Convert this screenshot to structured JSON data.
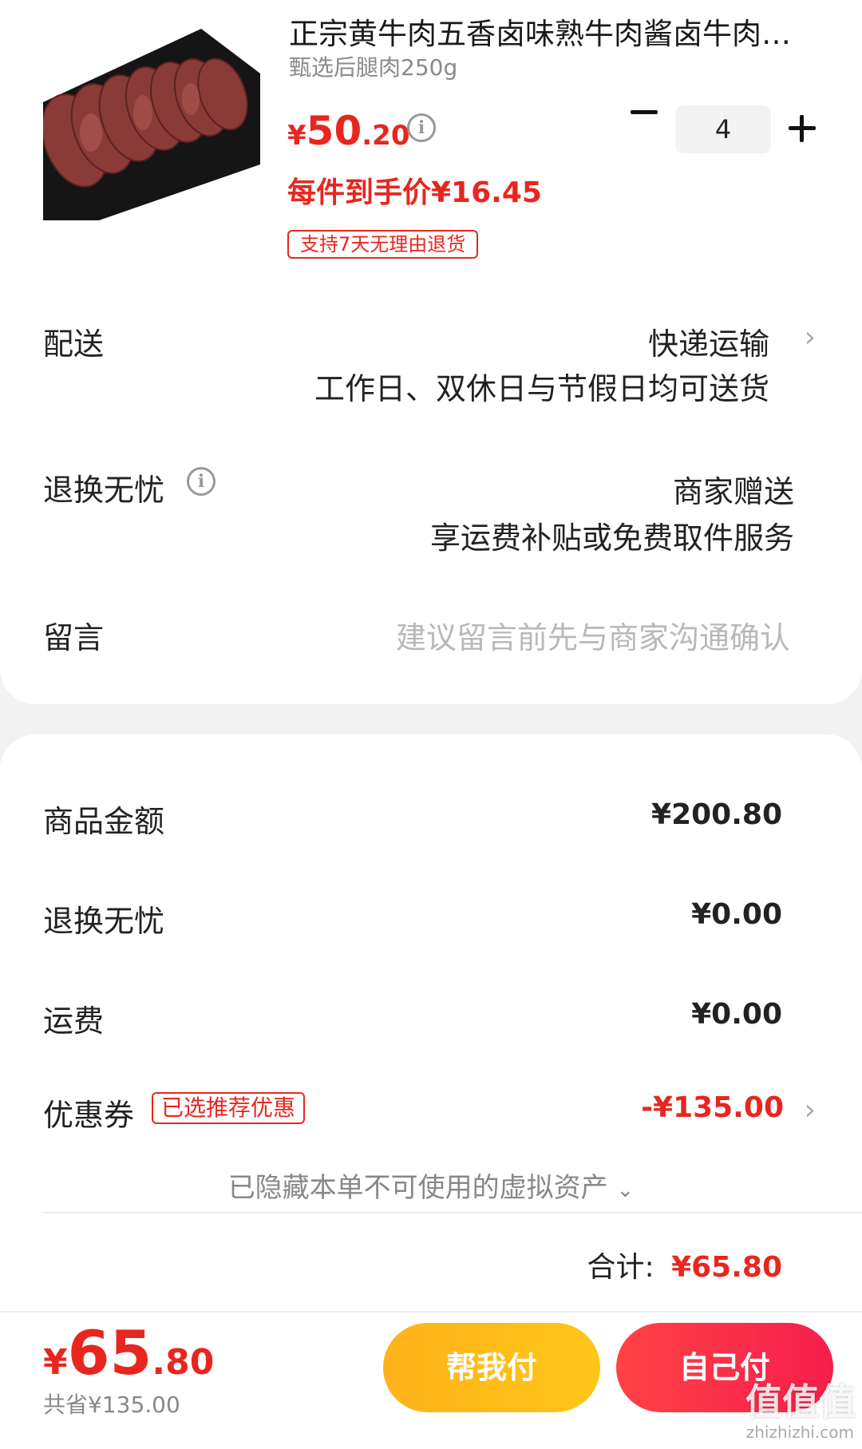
{
  "product": {
    "title": "正宗黄牛肉五香卤味熟牛肉酱卤牛肉…",
    "spec": "甄选后腿肉250g",
    "price_symbol": "¥",
    "price_int": "50",
    "price_dec": ".20",
    "unit_price": "每件到手价¥16.45",
    "return_tag": "支持7天无理由退货",
    "quantity": "4"
  },
  "delivery": {
    "label": "配送",
    "method": "快递运输",
    "note": "工作日、双休日与节假日均可送货"
  },
  "return_worry": {
    "label": "退换无忧",
    "value": "商家赠送",
    "note": "享运费补贴或免费取件服务"
  },
  "message": {
    "label": "留言",
    "placeholder": "建议留言前先与商家沟通确认"
  },
  "summary": {
    "goods_label": "商品金额",
    "goods_value": "¥200.80",
    "return_label": "退换无忧",
    "return_value": "¥0.00",
    "shipping_label": "运费",
    "shipping_value": "¥0.00",
    "coupon_label": "优惠券",
    "coupon_tag": "已选推荐优惠",
    "coupon_value": "-¥135.00",
    "hidden_assets": "已隐藏本单不可使用的虚拟资产",
    "total_label": "合计:",
    "total_value": "¥65.80"
  },
  "bottom": {
    "price_symbol": "¥",
    "price_int": "65",
    "price_dec": ".80",
    "saved": "共省¥135.00",
    "help_pay": "帮我付",
    "self_pay": "自己付"
  },
  "watermark": {
    "text": "值值值",
    "url": "zhizhizhi.com"
  },
  "colors": {
    "accent_red": "#e8261f",
    "button_yellow": "#ffb21a",
    "button_red": "#ff4245"
  }
}
